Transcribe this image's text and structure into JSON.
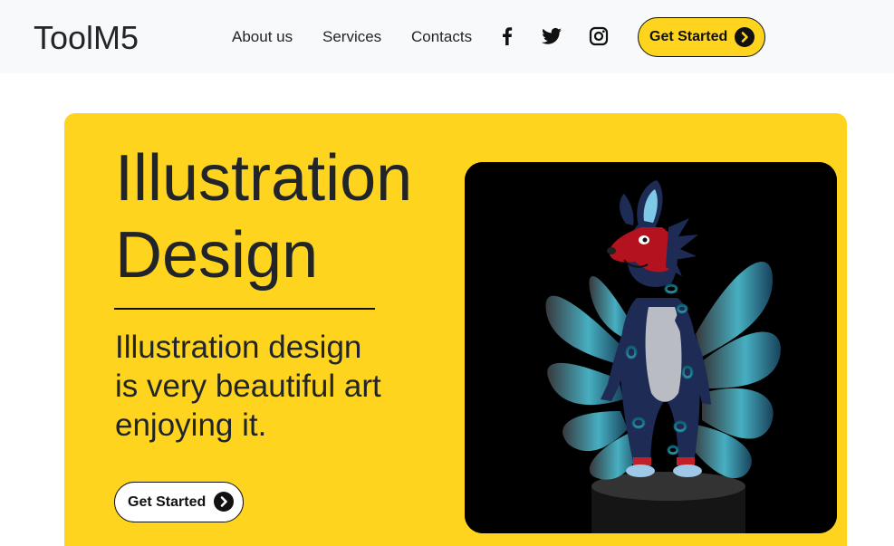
{
  "navbar": {
    "brand": "ToolM5",
    "links": [
      {
        "label": "About us"
      },
      {
        "label": "Services"
      },
      {
        "label": "Contacts"
      }
    ],
    "social": [
      {
        "icon": "facebook-icon"
      },
      {
        "icon": "twitter-icon"
      },
      {
        "icon": "instagram-icon"
      }
    ],
    "cta_label": "Get Started"
  },
  "hero": {
    "title_line1": "Illustration",
    "title_line2": "Design",
    "subtitle": "Illustration design is very beautiful art enjoying it.",
    "cta_label": "Get Started",
    "image_subject": "3d-fox-creature-illustration"
  },
  "colors": {
    "accent": "#ffd41e",
    "navbar_bg": "#f8f9fa",
    "text": "#212529",
    "image_bg": "#000000"
  }
}
